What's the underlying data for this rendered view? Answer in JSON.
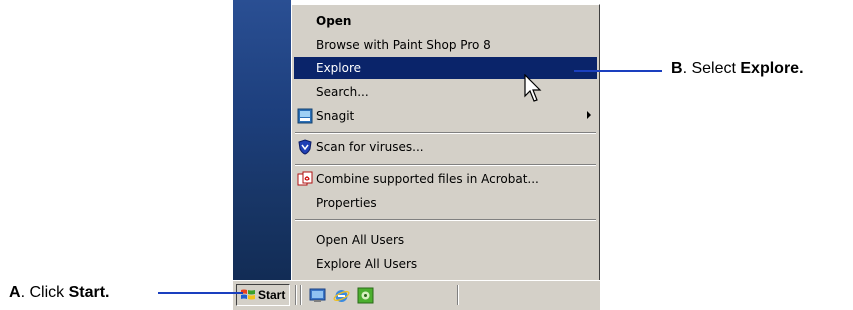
{
  "context_menu": {
    "items": [
      {
        "label": "Open"
      },
      {
        "label": "Browse with Paint Shop Pro 8"
      },
      {
        "label": "Explore"
      },
      {
        "label": "Search..."
      },
      {
        "label": "Snagit",
        "icon": "snagit-icon",
        "has_submenu": true
      },
      {
        "label": "Scan for viruses...",
        "icon": "shield-icon"
      },
      {
        "label": "Combine supported files in Acrobat...",
        "icon": "acrobat-icon"
      },
      {
        "label": "Properties"
      },
      {
        "label": "Open All Users"
      },
      {
        "label": "Explore All Users"
      }
    ],
    "highlighted_item": "Explore",
    "highlight_color": "#0a246a"
  },
  "taskbar": {
    "start_label": "Start",
    "quick_launch_icons": [
      "desktop-icon",
      "internet-explorer-icon",
      "media-icon"
    ]
  },
  "callouts": {
    "a": {
      "letter": "A",
      "text": ". Click ",
      "bold": "Start",
      "end": "."
    },
    "b": {
      "letter": "B",
      "text": ". Select ",
      "bold": "Explore",
      "end": "."
    }
  },
  "colors": {
    "menu_bg": "#d4d0c8",
    "desktop_blue": "#1d3f7d",
    "leader_line": "#1a3fbf"
  }
}
